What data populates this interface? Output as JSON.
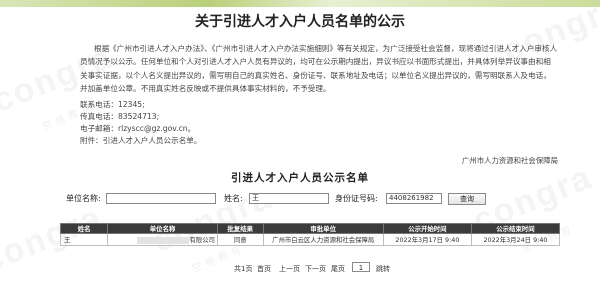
{
  "page": {
    "title": "关于引进人才入户人员名单的公示",
    "paragraph": "根据《广州市引进人才入户办法》、《广州市引进人才入户办法实施细则》等有关规定，为广泛接受社会监督，现将通过引进人才入户审核人员情况予以公示。任何单位和个人对引进人才入户人员有异议的，均可在公示期内提出，异议书应以书面形式提出，并具体列举异议事由和相关事实证据，以个人名义提出异议的，需写明自己的真实姓名、身份证号、联系地址及电话；以单位名义提出异议的，需写明联系人及电话，并加盖单位公章。不用真实姓名反映或不提供具体事实材料的，不予受理。",
    "contact": [
      {
        "label": "联系电话：",
        "value": "12345;"
      },
      {
        "label": "传真电话：",
        "value": "83524713;"
      },
      {
        "label": "电子邮箱：",
        "value": "rlzyscc@gz.gov.cn。"
      },
      {
        "label": "附件：",
        "value": "引进人才入户人员公示名单。"
      }
    ],
    "department": "广州市人力资源和社会保障局",
    "subtitle": "引进人才入户人员公示名单"
  },
  "search": {
    "unit_label": "单位名称:",
    "unit_value": "",
    "name_label": "姓名:",
    "name_value": "王",
    "id_label": "身份证号码:",
    "id_value": "4408261982",
    "button": "查询"
  },
  "table": {
    "headers": [
      "姓名",
      "单位名称",
      "批复结果",
      "审批单位",
      "公示开始时间",
      "公示结束时间"
    ],
    "rows": [
      {
        "name": "王",
        "unit": "有限公司",
        "result": "同意",
        "approver": "广州市白云区人力资源和社会保障局",
        "start": "2022年3月17日 9:40",
        "end": "2022年3月24日 9:40"
      }
    ]
  },
  "pager": {
    "total": "共1页",
    "first": "首页",
    "prev": "上一页",
    "next": "下一页",
    "last": "尾页",
    "current": "1",
    "go": "跳转"
  },
  "watermark": {
    "brand": "congra",
    "sub": "空格教育"
  }
}
